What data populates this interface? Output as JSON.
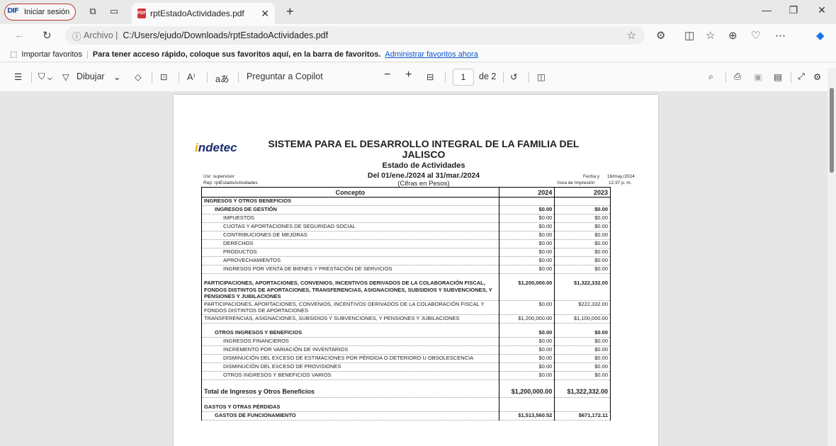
{
  "browser": {
    "profile_label": "Iniciar sesión",
    "profile_logo_text": "DIF",
    "tab_title": "rptEstadoActividades.pdf",
    "url_scheme": "Archivo",
    "url_path": "C:/Users/ejudo/Downloads/rptEstadoActividades.pdf",
    "favorites_import": "Importar favoritos",
    "favorites_message": "Para tener acceso rápido, coloque sus favoritos aquí, en la barra de favoritos.",
    "favorites_manage": "Administrar favoritos ahora"
  },
  "pdf_toolbar": {
    "draw_label": "Dibujar",
    "read_aloud": "A⁾",
    "translate": "aあ",
    "copilot_label": "Preguntar a Copilot",
    "page_current": "1",
    "page_total": "de 2"
  },
  "report": {
    "logo_text": "ndetec",
    "logo_initial": "i",
    "title": "SISTEMA PARA EL DESARROLLO INTEGRAL DE LA FAMILIA DEL JALISCO",
    "subtitle": "Estado de Actividades",
    "period": "Del 01/ene./2024 al 31/mar./2024",
    "units": "(Cifras en Pesos)",
    "user": "Usr: supervisor",
    "rep": "Rep: rptEstadoActividades",
    "date_label": "Fecha y",
    "date_value": "16/may./2024",
    "time_label": "hora de Impresión",
    "time_value": "12:37 p. m.",
    "columns": [
      "Concepto",
      "2024",
      "2023"
    ],
    "rows": [
      {
        "concept": "INGRESOS Y OTROS BENEFICIOS",
        "y2024": "",
        "y2023": ""
      },
      {
        "concept": "INGRESOS DE GESTIÓN",
        "y2024": "$0.00",
        "y2023": "$0.00"
      },
      {
        "concept": "IMPUESTOS",
        "y2024": "$0.00",
        "y2023": "$0.00"
      },
      {
        "concept": "CUOTAS Y APORTACIONES DE SEGURIDAD SOCIAL",
        "y2024": "$0.00",
        "y2023": "$0.00"
      },
      {
        "concept": "CONTRIBUCIONES DE MEJORAS",
        "y2024": "$0.00",
        "y2023": "$0.00"
      },
      {
        "concept": "DERECHOS",
        "y2024": "$0.00",
        "y2023": "$0.00"
      },
      {
        "concept": "PRODUCTOS",
        "y2024": "$0.00",
        "y2023": "$0.00"
      },
      {
        "concept": "APROVECHAMIENTOS",
        "y2024": "$0.00",
        "y2023": "$0.00"
      },
      {
        "concept": "INGRESOS POR VENTA DE BIENES Y PRESTACIÓN DE SERVICIOS",
        "y2024": "$0.00",
        "y2023": "$0.00"
      },
      {
        "concept": "PARTICIPACIONES, APORTACIONES, CONVENIOS, INCENTIVOS DERIVADOS DE LA COLABORACIÓN FISCAL, FONDOS DISTINTOS DE APORTACIONES, TRANSFERENCIAS, ASIGNACIONES, SUBSIDIOS Y SUBVENCIONES, Y PENSIONES Y JUBILACIONES",
        "y2024": "$1,200,000.00",
        "y2023": "$1,322,332.00"
      },
      {
        "concept": "PARTICIPACIONES, APORTACIONES, CONVENIOS, INCENTIVOS DERIVADOS DE LA COLABORACIÓN FISCAL Y FONDOS DISTINTOS DE APORTACIONES",
        "y2024": "$0.00",
        "y2023": "$222,332.00"
      },
      {
        "concept": "TRANSFERENCIAS, ASIGNACIONES, SUBSIDIOS Y SUBVENCIONES, Y PENSIONES Y JUBILACIONES",
        "y2024": "$1,200,000.00",
        "y2023": "$1,100,000.00"
      },
      {
        "concept": "OTROS INGRESOS Y BENEFICIOS",
        "y2024": "$0.00",
        "y2023": "$0.00"
      },
      {
        "concept": "INGRESOS FINANCIEROS",
        "y2024": "$0.00",
        "y2023": "$0.00"
      },
      {
        "concept": "INCREMENTO POR VARIACIÓN DE INVENTARIOS",
        "y2024": "$0.00",
        "y2023": "$0.00"
      },
      {
        "concept": "DISMINUCIÓN DEL EXCESO DE ESTIMACIONES POR PÉRDIDA O DETERIORO U OBSOLESCENCIA",
        "y2024": "$0.00",
        "y2023": "$0.00"
      },
      {
        "concept": "DISMINUCIÓN DEL EXCESO DE PROVISIONES",
        "y2024": "$0.00",
        "y2023": "$0.00"
      },
      {
        "concept": "OTROS INGRESOS Y BENEFICIOS VARIOS",
        "y2024": "$0.00",
        "y2023": "$0.00"
      },
      {
        "concept": "Total de Ingresos y Otros Beneficios",
        "y2024": "$1,200,000.00",
        "y2023": "$1,322,332.00"
      },
      {
        "concept": "GASTOS Y OTRAS PÉRDIDAS",
        "y2024": "",
        "y2023": ""
      },
      {
        "concept": "GASTOS DE FUNCIONAMIENTO",
        "y2024": "$1,513,560.52",
        "y2023": "$671,172.11"
      }
    ]
  }
}
